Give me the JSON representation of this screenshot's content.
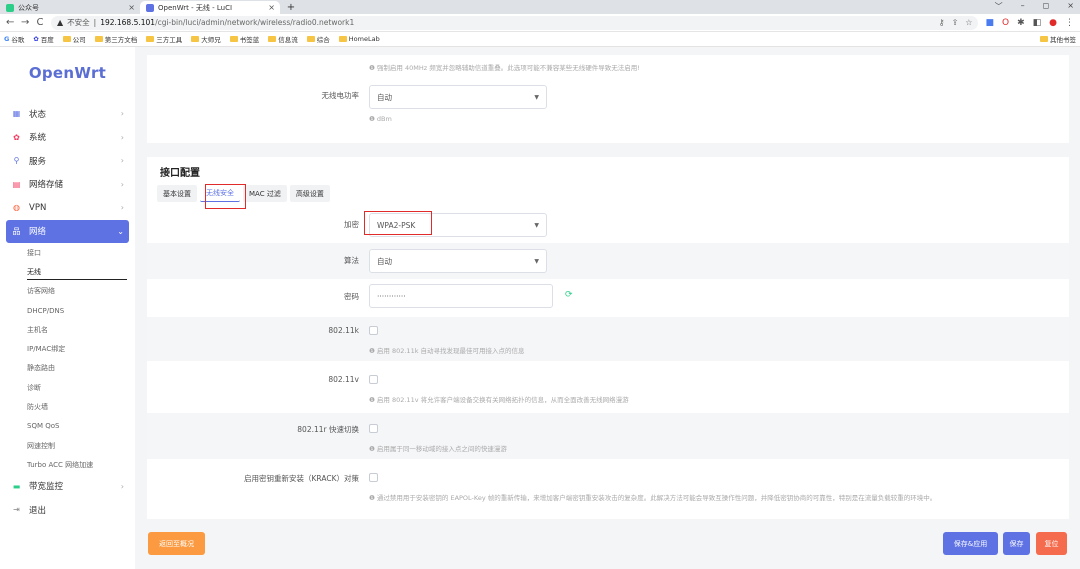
{
  "browser": {
    "tabs": [
      {
        "title": "公众号",
        "close": "×"
      },
      {
        "title": "OpenWrt - 无线 - LuCI",
        "close": "×"
      }
    ],
    "new_tab": "+",
    "window_controls": [
      "﹀",
      "–",
      "◻",
      "×"
    ],
    "nav": {
      "back": "←",
      "forward": "→",
      "reload": "C"
    },
    "address": {
      "warning": "▲",
      "security_label": "不安全",
      "separator": "|",
      "host": "192.168.5.101",
      "path": "/cgi-bin/luci/admin/network/wireless/radio0.network1"
    },
    "bookmarks": [
      "谷歌",
      "百度",
      "公司",
      "第三方文档",
      "三方工具",
      "大师兄",
      "书签蓝",
      "信息流",
      "综合",
      "HomeLab"
    ],
    "bookmark_other": "其他书签"
  },
  "sidebar": {
    "logo": "OpenWrt",
    "menu": [
      {
        "label": "状态",
        "icon": "grid-icon",
        "color": "#5e72e4"
      },
      {
        "label": "系统",
        "icon": "gear-icon",
        "color": "#f5365c"
      },
      {
        "label": "服务",
        "icon": "puzzle-icon",
        "color": "#5e72e4"
      },
      {
        "label": "网络存储",
        "icon": "storage-icon",
        "color": "#f5365c"
      },
      {
        "label": "VPN",
        "icon": "vpn-icon",
        "color": "#fb6340"
      },
      {
        "label": "网络",
        "icon": "network-icon",
        "color": "#ffffff"
      }
    ],
    "submenu": [
      "接口",
      "无线",
      "访客网络",
      "DHCP/DNS",
      "主机名",
      "IP/MAC绑定",
      "静态路由",
      "诊断",
      "防火墙",
      "SQM QoS",
      "网速控制",
      "Turbo ACC 网络加速"
    ],
    "menu_bottom": [
      {
        "label": "带宽监控",
        "icon": "monitor-icon",
        "color": "#2dce89"
      },
      {
        "label": "退出",
        "icon": "logout-icon",
        "color": "#888888"
      }
    ]
  },
  "top_card": {
    "note_40mhz": "❶ 强制启用 40MHz 频宽并忽略辅助信道重叠。此选项可能不兼容某些无线硬件导致无法启用!",
    "txpower_label": "无线电功率",
    "txpower_value": "自动",
    "txpower_unit": "❶ dBm"
  },
  "iface": {
    "title": "接口配置",
    "tabs": [
      "基本设置",
      "无线安全",
      "MAC 过滤",
      "高级设置"
    ],
    "encryption_label": "加密",
    "encryption_value": "WPA2-PSK",
    "cipher_label": "算法",
    "cipher_value": "自动",
    "key_label": "密码",
    "key_value": "············",
    "r80211k_label": "802.11k",
    "r80211k_help": "❶ 启用 802.11k 自动寻找发现最佳可用接入点的信息",
    "r80211v_label": "802.11v",
    "r80211v_help": "❶ 启用 802.11v 将允许客户端设备交换有关网络拓扑的信息，从而全面改善无线网络漫游",
    "r80211r_label": "802.11r 快速切换",
    "r80211r_help": "❶ 启用属于同一移动域的接入点之间的快速漫游",
    "krack_label": "启用密钥重新安装（KRACK）对策",
    "krack_help": "❶ 通过禁用用于安装密钥的 EAPOL-Key 帧的重新传输，来增加客户端密钥重安装攻击的复杂度。此解决方法可能会导致互操作性问题，并降低密钥协商的可靠性，特别是在流量负载较重的环境中。"
  },
  "buttons": {
    "back": "返回至概况",
    "save_apply": "保存&应用",
    "save": "保存",
    "reset": "复位"
  },
  "colors": {
    "primary": "#5e72e4",
    "orange": "#fb9a40",
    "reset": "#f56b4d",
    "highlight": "#e12b2b"
  }
}
